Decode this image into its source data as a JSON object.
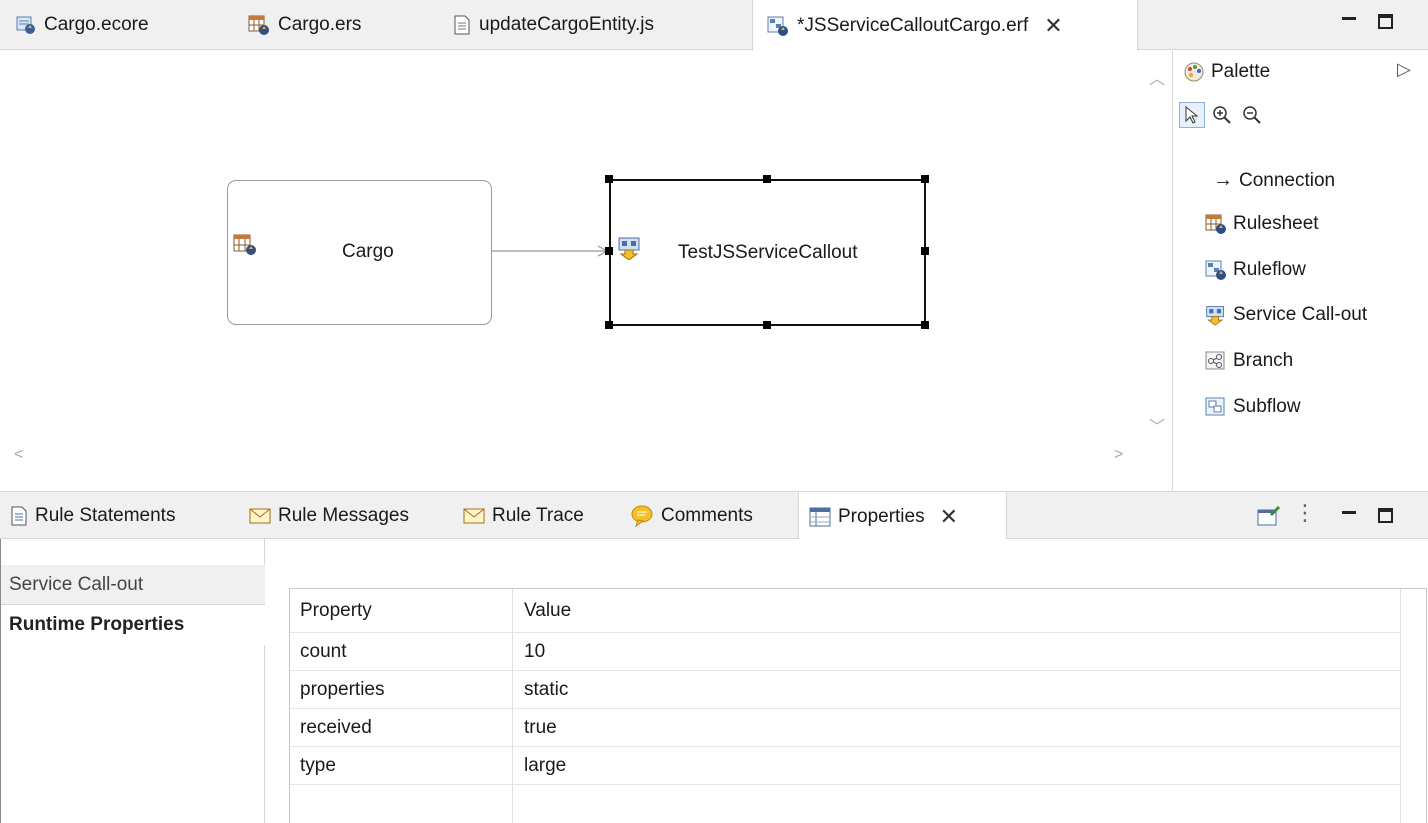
{
  "editor_tabs": [
    {
      "label": "Cargo.ecore",
      "icon": "ecore-model-icon"
    },
    {
      "label": "Cargo.ers",
      "icon": "rulesheet-icon"
    },
    {
      "label": "updateCargoEntity.js",
      "icon": "text-file-icon"
    },
    {
      "label": "*JSServiceCalloutCargo.erf",
      "icon": "ruleflow-icon",
      "active": true
    }
  ],
  "canvas": {
    "nodes": {
      "cargo": {
        "label": "Cargo",
        "icon": "rulesheet-icon"
      },
      "callout": {
        "label": "TestJSServiceCallout",
        "icon": "service-callout-icon",
        "selected": true
      }
    },
    "connection": {
      "from": "Cargo",
      "to": "TestJSServiceCallout"
    }
  },
  "palette": {
    "title": "Palette",
    "tools": [
      "select-arrow-icon",
      "zoom-in-icon",
      "zoom-out-icon"
    ],
    "items": [
      {
        "label": "Connection",
        "icon": "connection-arrow-icon",
        "glyph": "→"
      },
      {
        "label": "Rulesheet",
        "icon": "rulesheet-icon"
      },
      {
        "label": "Ruleflow",
        "icon": "ruleflow-icon"
      },
      {
        "label": "Service Call-out",
        "icon": "service-callout-icon"
      },
      {
        "label": "Branch",
        "icon": "branch-icon"
      },
      {
        "label": "Subflow",
        "icon": "subflow-icon"
      }
    ]
  },
  "view_tabs": [
    {
      "label": "Rule Statements",
      "icon": "document-icon"
    },
    {
      "label": "Rule Messages",
      "icon": "envelope-icon"
    },
    {
      "label": "Rule Trace",
      "icon": "envelope-icon"
    },
    {
      "label": "Comments",
      "icon": "comment-bubble-icon"
    },
    {
      "label": "Properties",
      "icon": "properties-table-icon",
      "active": true
    }
  ],
  "properties": {
    "side_tabs": [
      {
        "label": "Service Call-out",
        "active": false
      },
      {
        "label": "Runtime Properties",
        "active": true
      }
    ],
    "table": {
      "headers": [
        "Property",
        "Value"
      ],
      "rows": [
        {
          "property": "count",
          "value": "10"
        },
        {
          "property": "properties",
          "value": "static"
        },
        {
          "property": "received",
          "value": "true"
        },
        {
          "property": "type",
          "value": "large"
        }
      ]
    }
  },
  "colors": {
    "chrome_bg": "#f0f0f0",
    "border": "#d6d6d6",
    "selection_border": "#111111",
    "node_border": "#9a9a9a"
  }
}
